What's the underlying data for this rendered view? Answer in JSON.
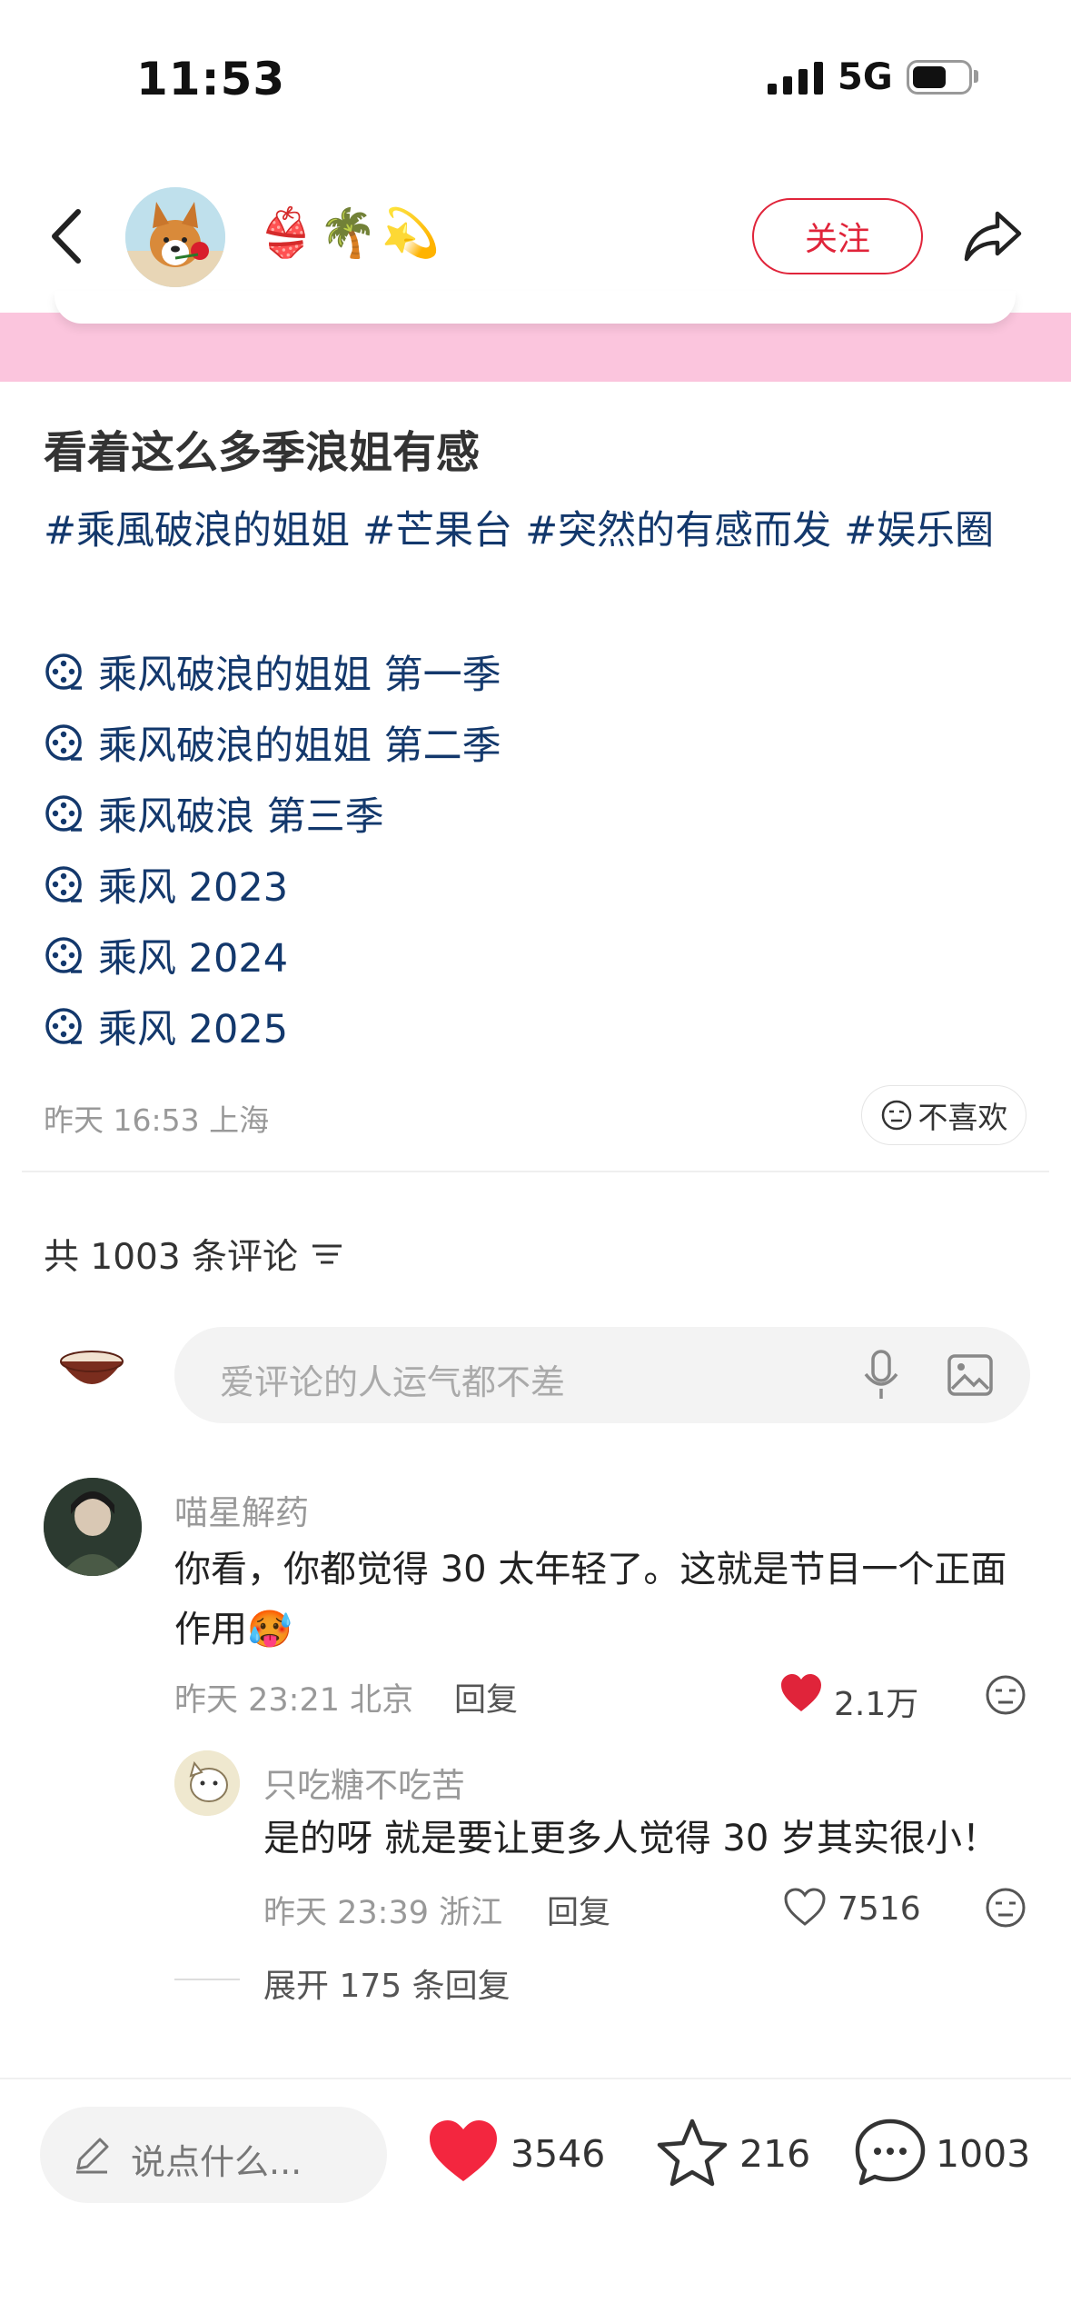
{
  "status_bar": {
    "time": "11:53",
    "network": "5G"
  },
  "header": {
    "author_emojis": "👙🌴💫",
    "follow_label": "关注"
  },
  "post": {
    "title": "看着这么多季浪姐有感",
    "tags": [
      "#乘風破浪的姐姐",
      "#芒果台",
      "#突然的有感而发",
      "#娱乐圈"
    ],
    "links": [
      "乘风破浪的姐姐 第一季",
      "乘风破浪的姐姐 第二季",
      "乘风破浪 第三季",
      "乘风 2023",
      "乘风 2024",
      "乘风 2025"
    ],
    "meta": "昨天 16:53 上海",
    "dislike_label": "不喜欢"
  },
  "comments_section": {
    "count_label": "共 1003 条评论",
    "input_placeholder": "爱评论的人运气都不差"
  },
  "comments": [
    {
      "name": "喵星解药",
      "text": "你看，你都觉得 30 太年轻了。这就是节目一个正面作用🥵",
      "meta": "昨天 23:21 北京",
      "reply_label": "回复",
      "likes": "2.1万",
      "liked": true
    }
  ],
  "reply": {
    "name": "只吃糖不吃苦",
    "text": "是的呀 就是要让更多人觉得 30 岁其实很小！",
    "meta": "昨天 23:39 浙江",
    "reply_label": "回复",
    "likes": "7516",
    "expand_label": "展开 175 条回复"
  },
  "bottom_bar": {
    "say_placeholder": "说点什么...",
    "likes": "3546",
    "stars": "216",
    "comments": "1003"
  },
  "colors": {
    "accent_red": "#e0243a",
    "tag_blue": "#13386c",
    "banner_pink": "#fbc5dd"
  }
}
